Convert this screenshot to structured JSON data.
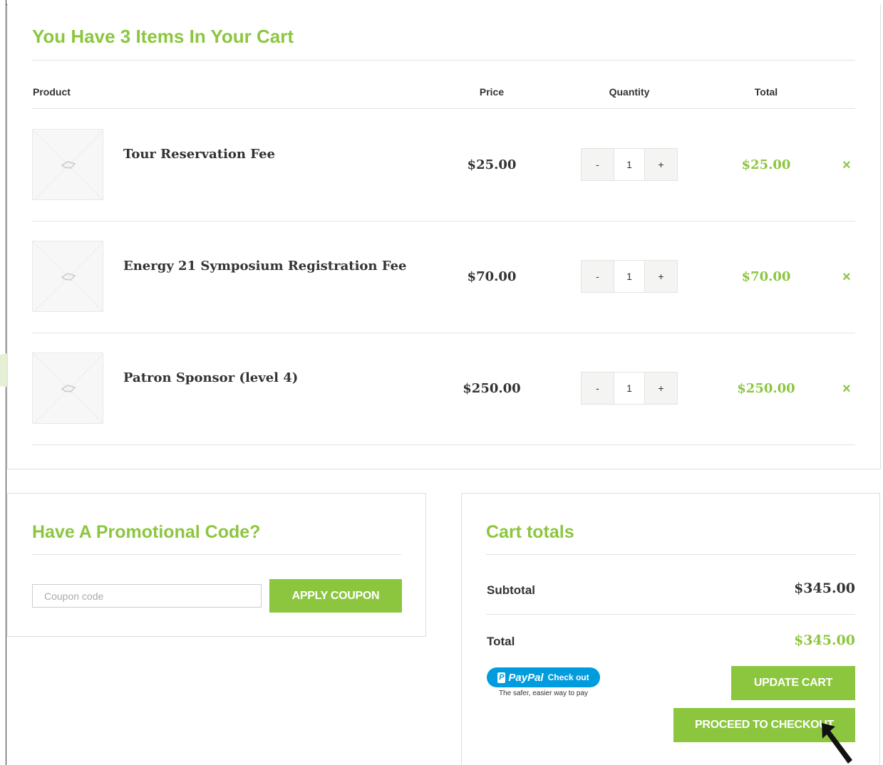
{
  "cart": {
    "title": "You Have 3 Items In Your Cart",
    "columns": {
      "product": "Product",
      "price": "Price",
      "quantity": "Quantity",
      "total": "Total"
    },
    "items": [
      {
        "name": "Tour Reservation Fee",
        "price": "$25.00",
        "quantity": "1",
        "total": "$25.00"
      },
      {
        "name": "Energy 21 Symposium Registration Fee",
        "price": "$70.00",
        "quantity": "1",
        "total": "$70.00"
      },
      {
        "name": "Patron Sponsor (level 4)",
        "price": "$250.00",
        "quantity": "1",
        "total": "$250.00"
      }
    ],
    "qty_minus": "-",
    "qty_plus": "+",
    "remove_glyph": "×",
    "image_placeholder_icon": "image-placeholder-icon",
    "remove_icon": "close-icon"
  },
  "promo": {
    "title": "Have A Promotional Code?",
    "coupon_placeholder": "Coupon code",
    "apply_label": "APPLY COUPON"
  },
  "totals": {
    "title": "Cart totals",
    "subtotal_label": "Subtotal",
    "subtotal_value": "$345.00",
    "total_label": "Total",
    "total_value": "$345.00",
    "paypal_logo": "PayPal",
    "paypal_action": "Check out",
    "paypal_tagline": "The safer, easier way to pay",
    "update_label": "UPDATE CART",
    "checkout_label": "PROCEED TO CHECKOUT"
  },
  "colors": {
    "accent": "#8cc63f",
    "paypal": "#009cde"
  }
}
